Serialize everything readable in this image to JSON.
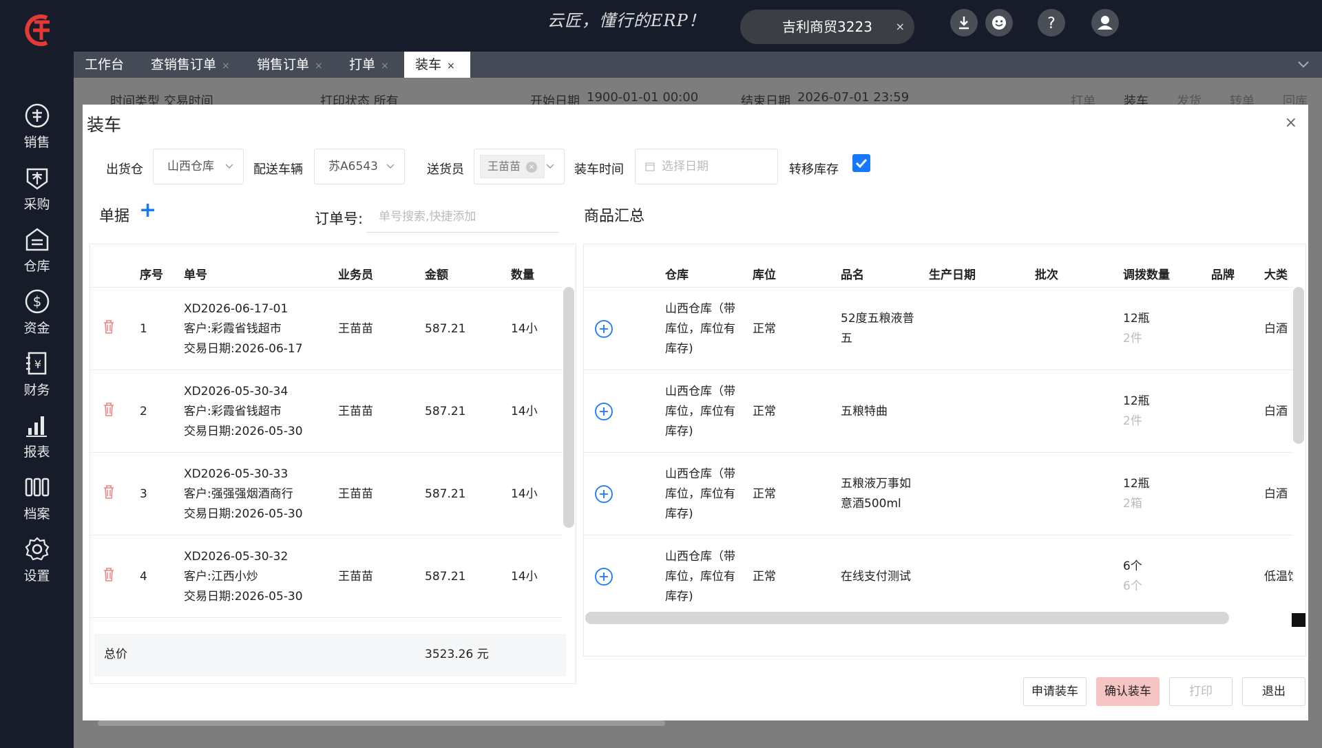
{
  "sidebar": {
    "items": [
      {
        "label": "销售",
        "icon": "sales-icon"
      },
      {
        "label": "采购",
        "icon": "purchase-icon"
      },
      {
        "label": "仓库",
        "icon": "warehouse-icon"
      },
      {
        "label": "资金",
        "icon": "funds-icon"
      },
      {
        "label": "财务",
        "icon": "finance-icon"
      },
      {
        "label": "报表",
        "icon": "report-icon"
      },
      {
        "label": "档案",
        "icon": "archive-icon"
      },
      {
        "label": "设置",
        "icon": "settings-icon"
      }
    ]
  },
  "header": {
    "slogan": "云匠，懂行的ERP！",
    "company": "吉利商贸3223",
    "company_close": "×"
  },
  "tabs": [
    {
      "label": "工作台",
      "close": ""
    },
    {
      "label": "查销售订单",
      "close": "×"
    },
    {
      "label": "销售订单",
      "close": "×"
    },
    {
      "label": "打单",
      "close": "×"
    },
    {
      "label": "装车",
      "close": "×"
    }
  ],
  "background": {
    "time_type": "时间类型 交易时间",
    "print_status": "打印状态 所有",
    "start_label": "开始日期",
    "start_value": "1900-01-01 00:00",
    "end_label": "结束日期",
    "end_value": "2026-07-01 23:59",
    "actions": [
      "打单",
      "装车",
      "发货",
      "转单",
      "回库"
    ]
  },
  "modal": {
    "title": "装车",
    "close": "×",
    "filters": {
      "warehouse_label": "出货仓",
      "warehouse_value": "山西仓库",
      "vehicle_label": "配送车辆",
      "vehicle_value": "苏A6543",
      "deliverer_label": "送货员",
      "deliverer_tag": "王苗苗",
      "load_time_label": "装车时间",
      "load_time_placeholder": "选择日期",
      "transfer_label": "转移库存",
      "transfer_checked": true
    },
    "docs": {
      "title": "单据",
      "order_label": "订单号:",
      "search_placeholder": "单号搜索,快捷添加",
      "columns": [
        "序号",
        "单号",
        "业务员",
        "金额",
        "数量"
      ],
      "rows": [
        {
          "seq": "1",
          "no": "XD2026-06-17-01",
          "customer": "客户:彩霞省钱超市",
          "date": "交易日期:2026-06-17",
          "salesman": "王苗苗",
          "amount": "587.21",
          "qty": "14小"
        },
        {
          "seq": "2",
          "no": "XD2026-05-30-34",
          "customer": "客户:彩霞省钱超市",
          "date": "交易日期:2026-05-30",
          "salesman": "王苗苗",
          "amount": "587.21",
          "qty": "14小"
        },
        {
          "seq": "3",
          "no": "XD2026-05-30-33",
          "customer": "客户:强强强烟酒商行",
          "date": "交易日期:2026-05-30",
          "salesman": "王苗苗",
          "amount": "587.21",
          "qty": "14小"
        },
        {
          "seq": "4",
          "no": "XD2026-05-30-32",
          "customer": "客户:江西小炒",
          "date": "交易日期:2026-05-30",
          "salesman": "王苗苗",
          "amount": "587.21",
          "qty": "14小"
        }
      ],
      "total_label": "总价",
      "total_value": "3523.26 元"
    },
    "summary": {
      "title": "商品汇总",
      "columns": [
        "仓库",
        "库位",
        "品名",
        "生产日期",
        "批次",
        "调拨数量",
        "品牌",
        "大类"
      ],
      "rows": [
        {
          "warehouse": [
            "山西仓库（带",
            "库位，库位有",
            "库存)"
          ],
          "location": "正常",
          "name": [
            "52度五粮液普",
            "五"
          ],
          "qty": "12瓶",
          "qty_sub": "2件",
          "category": "白酒"
        },
        {
          "warehouse": [
            "山西仓库（带",
            "库位，库位有",
            "库存)"
          ],
          "location": "正常",
          "name": [
            "五粮特曲"
          ],
          "qty": "12瓶",
          "qty_sub": "2件",
          "category": "白酒"
        },
        {
          "warehouse": [
            "山西仓库（带",
            "库位，库位有",
            "库存)"
          ],
          "location": "正常",
          "name": [
            "五粮液万事如",
            "意酒500ml"
          ],
          "qty": "12瓶",
          "qty_sub": "2箱",
          "category": "白酒"
        },
        {
          "warehouse": [
            "山西仓库（带",
            "库位，库位有",
            "库存)"
          ],
          "location": "正常",
          "name": [
            "在线支付测试"
          ],
          "qty": "6个",
          "qty_sub": "6个",
          "category": "低温饮"
        }
      ]
    },
    "buttons": {
      "apply": "申请装车",
      "confirm": "确认装车",
      "print": "打印",
      "exit": "退出"
    }
  }
}
